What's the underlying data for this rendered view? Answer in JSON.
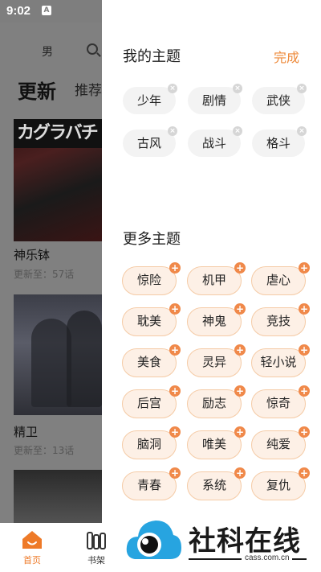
{
  "status_bar": {
    "time": "9:02",
    "sim_label": "A"
  },
  "background": {
    "tab_male": "男",
    "heading_update": "更新",
    "heading_recommend": "推荐",
    "books": [
      {
        "title": "神乐钵",
        "update": "更新至：57话",
        "cover_text": "カグラバチ"
      },
      {
        "title": "精卫",
        "update": "更新至：13话"
      }
    ]
  },
  "panel": {
    "my_themes_title": "我的主题",
    "done_label": "完成",
    "my_themes": [
      "少年",
      "剧情",
      "武侠",
      "古风",
      "战斗",
      "格斗"
    ],
    "more_themes_title": "更多主题",
    "more_themes": [
      "惊险",
      "机甲",
      "虐心",
      "耽美",
      "神鬼",
      "竞技",
      "美食",
      "灵异",
      "轻小说",
      "后宫",
      "励志",
      "惊奇",
      "脑洞",
      "唯美",
      "纯爱",
      "青春",
      "系统",
      "复仇"
    ]
  },
  "bottom_nav": {
    "home": "首页",
    "shelf": "书架"
  },
  "watermark": {
    "text": "社科在线",
    "url": "cass.com.cn"
  },
  "colors": {
    "accent": "#ee8a3a",
    "chip_bg": "#fdf0e6",
    "dim_bg": "#808080"
  }
}
